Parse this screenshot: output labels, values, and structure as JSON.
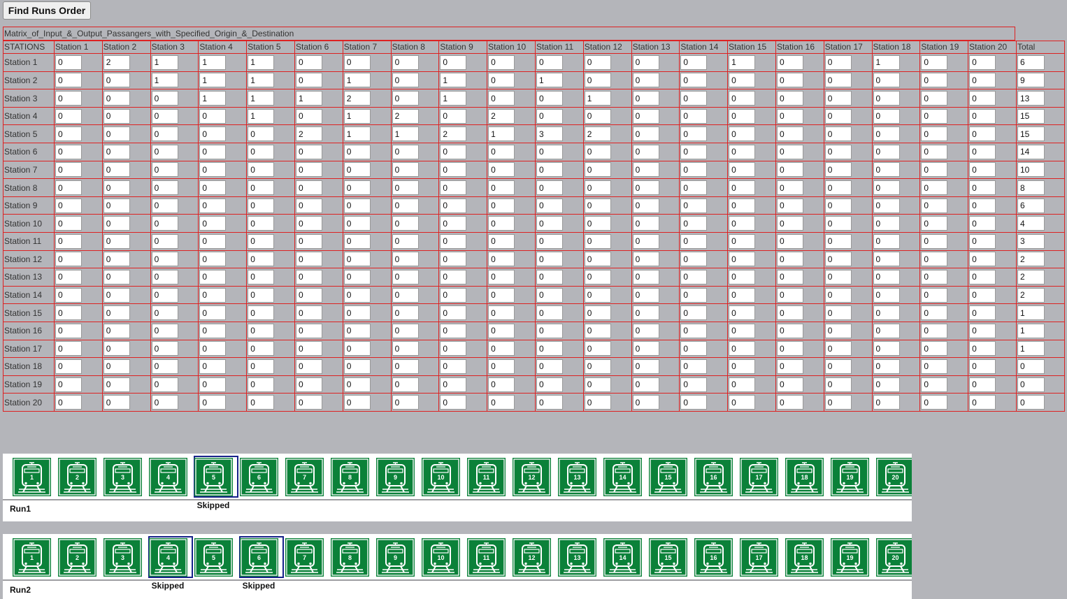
{
  "toolbar": {
    "find_label": "Find Runs Order"
  },
  "matrix": {
    "title": "Matrix_of_Input_&_Output_Passangers_with_Specified_Origin_&_Destination",
    "corner": "STATIONS",
    "columns": [
      "Station 1",
      "Station 2",
      "Station 3",
      "Station 4",
      "Station 5",
      "Station 6",
      "Station 7",
      "Station 8",
      "Station 9",
      "Station 10",
      "Station 11",
      "Station 12",
      "Station 13",
      "Station 14",
      "Station 15",
      "Station 16",
      "Station 17",
      "Station 18",
      "Station 19",
      "Station 20"
    ],
    "total_label": "Total",
    "rows": [
      {
        "label": "Station 1",
        "values": [
          "0",
          "2",
          "1",
          "1",
          "1",
          "0",
          "0",
          "0",
          "0",
          "0",
          "0",
          "0",
          "0",
          "0",
          "1",
          "0",
          "0",
          "1",
          "0",
          "0"
        ],
        "total": "6"
      },
      {
        "label": "Station 2",
        "values": [
          "0",
          "0",
          "1",
          "1",
          "1",
          "0",
          "1",
          "0",
          "1",
          "0",
          "1",
          "0",
          "0",
          "0",
          "0",
          "0",
          "0",
          "0",
          "0",
          "0"
        ],
        "total": "9"
      },
      {
        "label": "Station 3",
        "values": [
          "0",
          "0",
          "0",
          "1",
          "1",
          "1",
          "2",
          "0",
          "1",
          "0",
          "0",
          "1",
          "0",
          "0",
          "0",
          "0",
          "0",
          "0",
          "0",
          "0"
        ],
        "total": "13"
      },
      {
        "label": "Station 4",
        "values": [
          "0",
          "0",
          "0",
          "0",
          "1",
          "0",
          "1",
          "2",
          "0",
          "2",
          "0",
          "0",
          "0",
          "0",
          "0",
          "0",
          "0",
          "0",
          "0",
          "0"
        ],
        "total": "15"
      },
      {
        "label": "Station 5",
        "values": [
          "0",
          "0",
          "0",
          "0",
          "0",
          "2",
          "1",
          "1",
          "2",
          "1",
          "3",
          "2",
          "0",
          "0",
          "0",
          "0",
          "0",
          "0",
          "0",
          "0"
        ],
        "total": "15"
      },
      {
        "label": "Station 6",
        "values": [
          "0",
          "0",
          "0",
          "0",
          "0",
          "0",
          "0",
          "0",
          "0",
          "0",
          "0",
          "0",
          "0",
          "0",
          "0",
          "0",
          "0",
          "0",
          "0",
          "0"
        ],
        "total": "14"
      },
      {
        "label": "Station 7",
        "values": [
          "0",
          "0",
          "0",
          "0",
          "0",
          "0",
          "0",
          "0",
          "0",
          "0",
          "0",
          "0",
          "0",
          "0",
          "0",
          "0",
          "0",
          "0",
          "0",
          "0"
        ],
        "total": "10"
      },
      {
        "label": "Station 8",
        "values": [
          "0",
          "0",
          "0",
          "0",
          "0",
          "0",
          "0",
          "0",
          "0",
          "0",
          "0",
          "0",
          "0",
          "0",
          "0",
          "0",
          "0",
          "0",
          "0",
          "0"
        ],
        "total": "8"
      },
      {
        "label": "Station 9",
        "values": [
          "0",
          "0",
          "0",
          "0",
          "0",
          "0",
          "0",
          "0",
          "0",
          "0",
          "0",
          "0",
          "0",
          "0",
          "0",
          "0",
          "0",
          "0",
          "0",
          "0"
        ],
        "total": "6"
      },
      {
        "label": "Station 10",
        "values": [
          "0",
          "0",
          "0",
          "0",
          "0",
          "0",
          "0",
          "0",
          "0",
          "0",
          "0",
          "0",
          "0",
          "0",
          "0",
          "0",
          "0",
          "0",
          "0",
          "0"
        ],
        "total": "4"
      },
      {
        "label": "Station 11",
        "values": [
          "0",
          "0",
          "0",
          "0",
          "0",
          "0",
          "0",
          "0",
          "0",
          "0",
          "0",
          "0",
          "0",
          "0",
          "0",
          "0",
          "0",
          "0",
          "0",
          "0"
        ],
        "total": "3"
      },
      {
        "label": "Station 12",
        "values": [
          "0",
          "0",
          "0",
          "0",
          "0",
          "0",
          "0",
          "0",
          "0",
          "0",
          "0",
          "0",
          "0",
          "0",
          "0",
          "0",
          "0",
          "0",
          "0",
          "0"
        ],
        "total": "2"
      },
      {
        "label": "Station 13",
        "values": [
          "0",
          "0",
          "0",
          "0",
          "0",
          "0",
          "0",
          "0",
          "0",
          "0",
          "0",
          "0",
          "0",
          "0",
          "0",
          "0",
          "0",
          "0",
          "0",
          "0"
        ],
        "total": "2"
      },
      {
        "label": "Station 14",
        "values": [
          "0",
          "0",
          "0",
          "0",
          "0",
          "0",
          "0",
          "0",
          "0",
          "0",
          "0",
          "0",
          "0",
          "0",
          "0",
          "0",
          "0",
          "0",
          "0",
          "0"
        ],
        "total": "2"
      },
      {
        "label": "Station 15",
        "values": [
          "0",
          "0",
          "0",
          "0",
          "0",
          "0",
          "0",
          "0",
          "0",
          "0",
          "0",
          "0",
          "0",
          "0",
          "0",
          "0",
          "0",
          "0",
          "0",
          "0"
        ],
        "total": "1"
      },
      {
        "label": "Station 16",
        "values": [
          "0",
          "0",
          "0",
          "0",
          "0",
          "0",
          "0",
          "0",
          "0",
          "0",
          "0",
          "0",
          "0",
          "0",
          "0",
          "0",
          "0",
          "0",
          "0",
          "0"
        ],
        "total": "1"
      },
      {
        "label": "Station 17",
        "values": [
          "0",
          "0",
          "0",
          "0",
          "0",
          "0",
          "0",
          "0",
          "0",
          "0",
          "0",
          "0",
          "0",
          "0",
          "0",
          "0",
          "0",
          "0",
          "0",
          "0"
        ],
        "total": "1"
      },
      {
        "label": "Station 18",
        "values": [
          "0",
          "0",
          "0",
          "0",
          "0",
          "0",
          "0",
          "0",
          "0",
          "0",
          "0",
          "0",
          "0",
          "0",
          "0",
          "0",
          "0",
          "0",
          "0",
          "0"
        ],
        "total": "0"
      },
      {
        "label": "Station 19",
        "values": [
          "0",
          "0",
          "0",
          "0",
          "0",
          "0",
          "0",
          "0",
          "0",
          "0",
          "0",
          "0",
          "0",
          "0",
          "0",
          "0",
          "0",
          "0",
          "0",
          "0"
        ],
        "total": "0"
      },
      {
        "label": "Station 20",
        "values": [
          "0",
          "0",
          "0",
          "0",
          "0",
          "0",
          "0",
          "0",
          "0",
          "0",
          "0",
          "0",
          "0",
          "0",
          "0",
          "0",
          "0",
          "0",
          "0",
          "0"
        ],
        "total": "0"
      }
    ]
  },
  "runs": [
    {
      "label": "Run1",
      "skipped": [
        5
      ],
      "skip_label": "Skipped"
    },
    {
      "label": "Run2",
      "skipped": [
        4,
        6
      ],
      "skip_label": "Skipped"
    }
  ],
  "stations": [
    "1",
    "2",
    "3",
    "4",
    "5",
    "6",
    "7",
    "8",
    "9",
    "10",
    "11",
    "12",
    "13",
    "14",
    "15",
    "16",
    "17",
    "18",
    "19",
    "20"
  ],
  "icon": {
    "name": "train-station-icon",
    "color": "#0b8139"
  }
}
